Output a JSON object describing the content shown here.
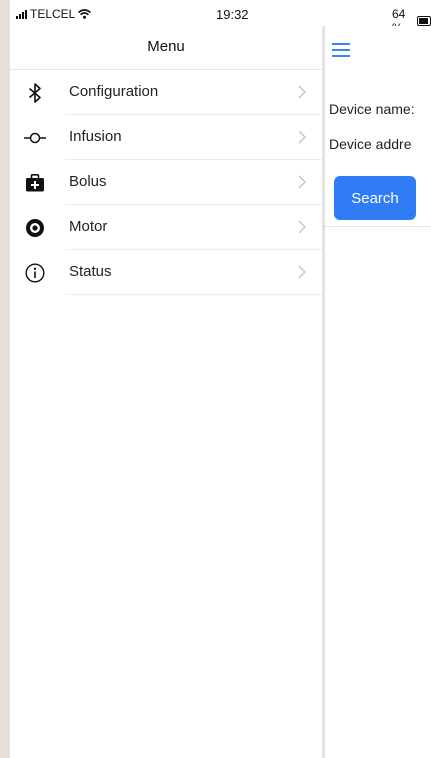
{
  "status_bar": {
    "carrier": "TELCEL",
    "time": "19:32",
    "battery_percent": "64 %",
    "battery_level": 0.64,
    "icons": [
      "signal-bars-icon",
      "wifi-icon",
      "battery-icon"
    ]
  },
  "drawer": {
    "title": "Menu",
    "items": [
      {
        "label": "Configuration",
        "icon": "bluetooth-icon"
      },
      {
        "label": "Infusion",
        "icon": "commit-node-icon"
      },
      {
        "label": "Bolus",
        "icon": "medical-kit-icon"
      },
      {
        "label": "Motor",
        "icon": "target-icon"
      },
      {
        "label": "Status",
        "icon": "info-icon"
      }
    ]
  },
  "main": {
    "device_name_label": "Device name:",
    "device_address_label": "Device addre",
    "search_button": "Search",
    "accent_color": "#2f7cf6"
  }
}
